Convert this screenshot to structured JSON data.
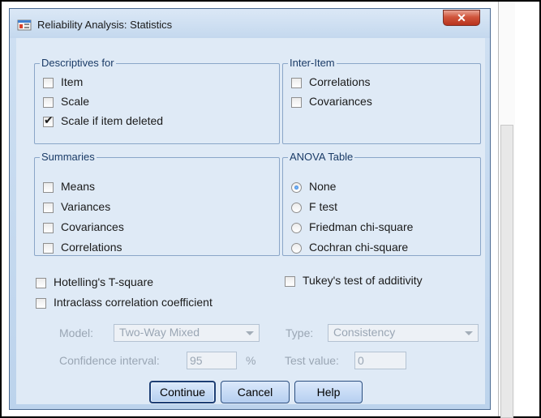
{
  "window": {
    "title": "Reliability Analysis: Statistics",
    "close_glyph": "✕"
  },
  "descriptives": {
    "title": "Descriptives for",
    "items": [
      {
        "label": "Item",
        "checked": false
      },
      {
        "label": "Scale",
        "checked": false
      },
      {
        "label": "Scale if item deleted",
        "checked": true
      }
    ]
  },
  "inter_item": {
    "title": "Inter-Item",
    "items": [
      {
        "label": "Correlations",
        "checked": false
      },
      {
        "label": "Covariances",
        "checked": false
      }
    ]
  },
  "summaries": {
    "title": "Summaries",
    "items": [
      {
        "label": "Means",
        "checked": false
      },
      {
        "label": "Variances",
        "checked": false
      },
      {
        "label": "Covariances",
        "checked": false
      },
      {
        "label": "Correlations",
        "checked": false
      }
    ]
  },
  "anova": {
    "title": "ANOVA Table",
    "options": [
      {
        "label": "None",
        "selected": true
      },
      {
        "label": "F test",
        "selected": false
      },
      {
        "label": "Friedman chi-square",
        "selected": false
      },
      {
        "label": "Cochran chi-square",
        "selected": false
      }
    ]
  },
  "extra": {
    "hotelling": "Hotelling's T-square",
    "tukey": "Tukey's test of additivity",
    "icc": "Intraclass correlation coefficient"
  },
  "icc": {
    "model_label": "Model:",
    "model_value": "Two-Way Mixed",
    "type_label": "Type:",
    "type_value": "Consistency",
    "ci_label": "Confidence interval:",
    "ci_value": "95",
    "ci_unit": "%",
    "test_label": "Test value:",
    "test_value": "0"
  },
  "buttons": {
    "continue": "Continue",
    "cancel": "Cancel",
    "help": "Help"
  },
  "colors": {
    "accent": "#1e6fd1",
    "close_button": "#c8452d"
  }
}
